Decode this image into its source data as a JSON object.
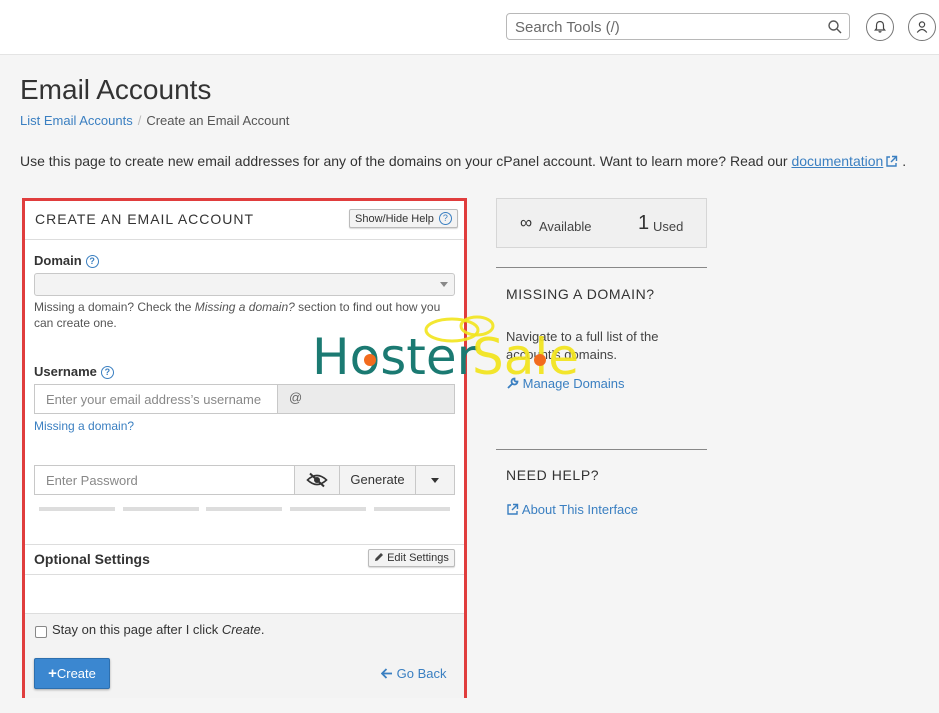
{
  "header": {
    "search_placeholder": "Search Tools (/)"
  },
  "page": {
    "title": "Email Accounts",
    "breadcrumb": {
      "link": "List Email Accounts",
      "separator": "/",
      "current": "Create an Email Account"
    },
    "intro_text": "Use this page to create new email addresses for any of the domains on your cPanel account. Want to learn more? Read our",
    "intro_link": "documentation",
    "intro_end": "."
  },
  "form": {
    "title": "CREATE AN EMAIL ACCOUNT",
    "show_hide_help": "Show/Hide Help",
    "domain_label": "Domain",
    "domain_hint_pre": "Missing a domain? Check the ",
    "domain_hint_em": "Missing a domain?",
    "domain_hint_post": " section to find out how you can create one.",
    "username_label": "Username",
    "username_placeholder": "Enter your email address’s username",
    "at_symbol": "@",
    "missing_domain_link": "Missing a domain?",
    "password_placeholder": "Enter Password",
    "generate_label": "Generate",
    "optional_settings": "Optional Settings",
    "edit_settings": "Edit Settings",
    "stay_pre": "Stay on this page after I click ",
    "stay_em": "Create",
    "stay_post": ".",
    "stay_checked": false,
    "create_label": "Create",
    "go_back_label": "Go Back"
  },
  "sidebar": {
    "available_symbol": "∞",
    "available_label": "Available",
    "used_count": "1",
    "used_label": "Used",
    "missing_heading": "MISSING A DOMAIN?",
    "missing_text": "Navigate to a full list of the account’s domains.",
    "manage_domains": "Manage Domains",
    "help_heading": "NEED HELP?",
    "about_link": "About This Interface"
  },
  "watermark": {
    "text_part1": "Hoster",
    "text_part2": "Sale"
  },
  "colors": {
    "accent": "#3a7fc1",
    "highlight_border": "#e03d3d",
    "primary_button": "#3b87d0",
    "watermark_teal": "#1b7a72",
    "watermark_yellow": "#f2e41c",
    "watermark_orange": "#f26b1d"
  }
}
